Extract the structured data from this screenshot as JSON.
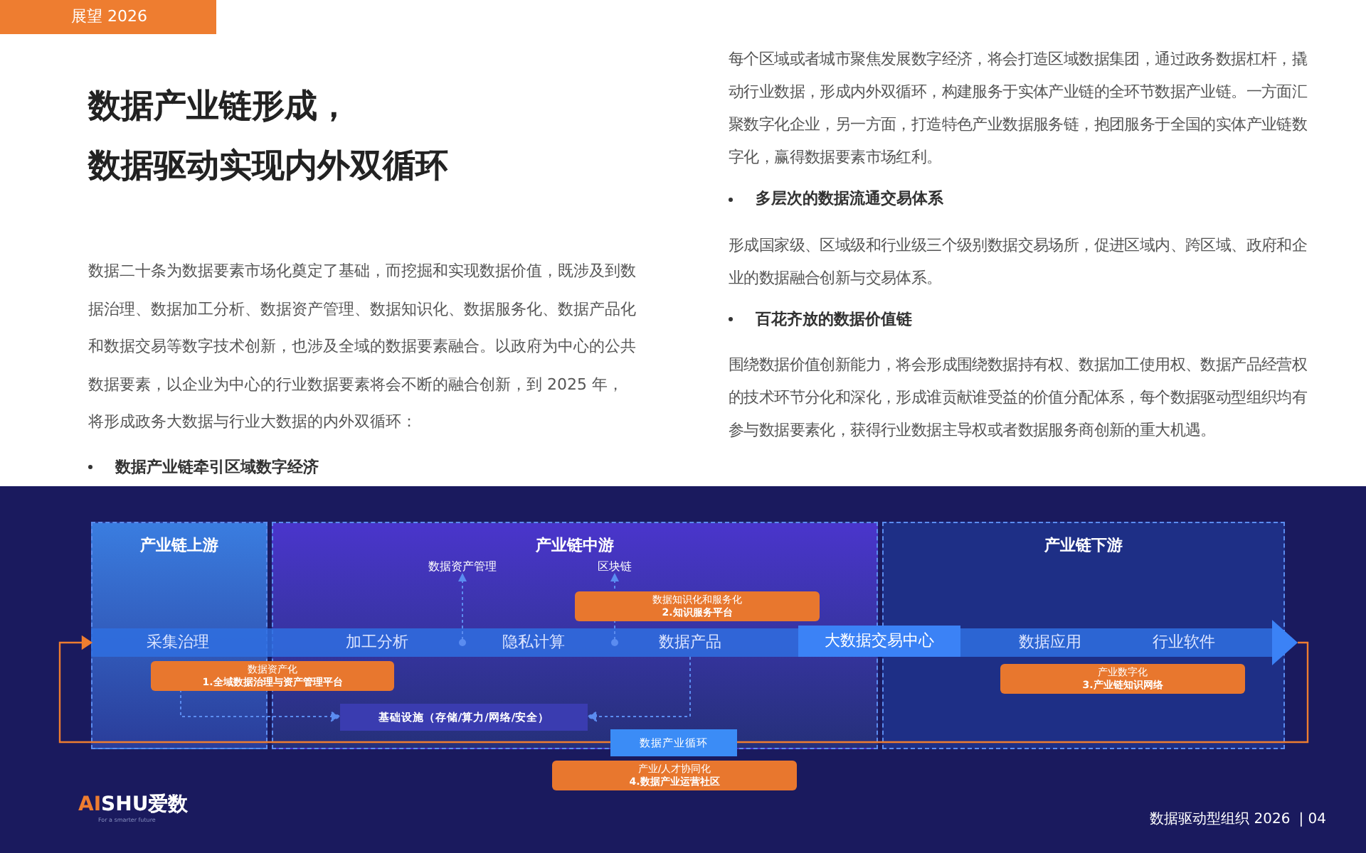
{
  "header_tab": "展望 2026",
  "title_lines": [
    "数据产业链形成，",
    "数据驱动实现内外双循环"
  ],
  "left_column": [
    {
      "kind": "paragraph",
      "text": "数据二十条为数据要素市场化奠定了基础，而挖掘和实现数据价值，既涉及到数据治理、数据加工分析、数据资产管理、数据知识化、数据服务化、数据产品化和数据交易等数字技术创新，也涉及全域的数据要素融合。以政府为中心的公共数据要素，以企业为中心的行业数据要素将会不断的融合创新，到 2025 年，将形成政务大数据与行业大数据的内外双循环："
    },
    {
      "kind": "bullet",
      "text": "数据产业链牵引区域数字经济"
    }
  ],
  "right_column": [
    {
      "kind": "paragraph",
      "text": "每个区域或者城市聚焦发展数字经济，将会打造区域数据集团，通过政务数据杠杆，撬动行业数据，形成内外双循环，构建服务于实体产业链的全环节数据产业链。一方面汇聚数字化企业，另一方面，打造特色产业数据服务链，抱团服务于全国的实体产业链数字化，赢得数据要素市场红利。"
    },
    {
      "kind": "bullet",
      "text": "多层次的数据流通交易体系"
    },
    {
      "kind": "paragraph",
      "text": "形成国家级、区域级和行业级三个级别数据交易场所，促进区域内、跨区域、政府和企业的数据融合创新与交易体系。"
    },
    {
      "kind": "bullet",
      "text": "百花齐放的数据价值链"
    },
    {
      "kind": "paragraph",
      "text": "围绕数据价值创新能力，将会形成围绕数据持有权、数据加工使用权、数据产品经营权的技术环节分化和深化，形成谁贡献谁受益的价值分配体系，每个数据驱动型组织均有参与数据要素化，获得行业数据主导权或者数据服务商创新的重大机遇。"
    }
  ],
  "diagram": {
    "zones": [
      {
        "label": "产业链上游"
      },
      {
        "label": "产业链中游"
      },
      {
        "label": "产业链下游"
      }
    ],
    "stages": [
      {
        "kind": "stage",
        "label": "采集治理"
      },
      {
        "kind": "stage",
        "label": "加工分析"
      },
      {
        "kind": "stage",
        "label": "隐私计算"
      },
      {
        "kind": "stage",
        "label": "数据产品"
      },
      {
        "kind": "hub",
        "label": "大数据交易中心"
      },
      {
        "kind": "stage",
        "label": "数据应用"
      },
      {
        "kind": "stage",
        "label": "行业软件"
      }
    ],
    "branches": [
      "数据资产管理",
      "区块链"
    ],
    "platforms": [
      {
        "title": "数据资产化",
        "subtitle": "1.全域数据治理与资产管理平台"
      },
      {
        "title": "数据知识化和服务化",
        "subtitle": "2.知识服务平台"
      },
      {
        "title": "产业数字化",
        "subtitle": "3.产业链知识网络"
      },
      {
        "title": "产业/人才协同化",
        "subtitle": "4.数据产业运营社区"
      }
    ],
    "infrastructure": "基础设施（存储/算力/网络/安全）",
    "cycle": "数据产业循环"
  },
  "footer": {
    "logo_accent": "AI",
    "logo_rest": "SHU爱数",
    "tagline": "For a smarter future",
    "doc_title": "数据驱动型组织 2026",
    "page_number": "| 04"
  }
}
